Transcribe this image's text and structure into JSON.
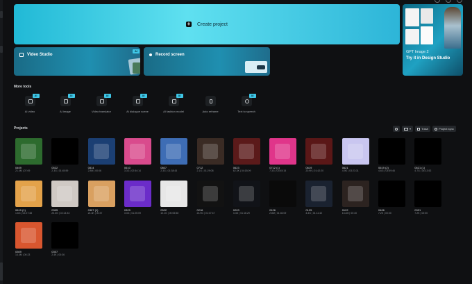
{
  "create": {
    "label": "Create project"
  },
  "tiles": {
    "video_studio": {
      "label": "Video Studio",
      "badge": "AI"
    },
    "record_screen": {
      "label": "Record screen"
    }
  },
  "promo": {
    "line1": "GPT Image 2",
    "line2": "Try it in Design Studio"
  },
  "more_tools": {
    "title": "More tools",
    "items": [
      {
        "label": "AI video",
        "icon": "ai-video-icon",
        "badge": "AI"
      },
      {
        "label": "AI image",
        "icon": "ai-image-icon",
        "badge": "AI"
      },
      {
        "label": "Video translator",
        "icon": "translate-icon",
        "badge": "AI"
      },
      {
        "label": "AI dialogue scene",
        "icon": "dialogue-icon",
        "badge": "AI"
      },
      {
        "label": "AI fashion model",
        "icon": "fashion-icon",
        "badge": "AI"
      },
      {
        "label": "Auto reframe",
        "icon": "reframe-icon"
      },
      {
        "label": "Text to speech",
        "icon": "tts-icon",
        "badge": "AI"
      }
    ]
  },
  "projects": {
    "title": "Projects",
    "actions": {
      "trash": "Trash",
      "sync": "Project sync"
    },
    "items": [
      {
        "name": "0409",
        "meta": "21.4M | 07:09",
        "color": "#2d6b2e"
      },
      {
        "name": "0522",
        "meta": "2.3G | 01:45:59",
        "color": "#000000"
      },
      {
        "name": "0814",
        "meta": "2.8M | 00:06",
        "color": "#1b3f73"
      },
      {
        "name": "0610",
        "meta": "3.3G | 02:54:14",
        "color": "#d94b8d"
      },
      {
        "name": "0807",
        "meta": "2.3G | 01:38:43",
        "color": "#3e6db5"
      },
      {
        "name": "0712",
        "meta": "2.1G | 01:29:08",
        "color": "#3a2b24"
      },
      {
        "name": "0623",
        "meta": "62.3K | 04:18:09",
        "color": "#5b1a1a"
      },
      {
        "name": "0712 (1)",
        "meta": "7.3G | 03:45:15",
        "color": "#e0358a"
      },
      {
        "name": "0619",
        "meta": "20.9K | 01:42:20",
        "color": "#5a1717"
      },
      {
        "name": "0621",
        "meta": "4.9G | 03:23:31",
        "color": "#c9c6f0"
      },
      {
        "name": "0619 (2)",
        "meta": "4.6G | 03:59:46",
        "color": "#000000"
      },
      {
        "name": "0621 (1)",
        "meta": "4.7G | 04:13:52",
        "color": "#000000"
      },
      {
        "name": "0619 (1)",
        "meta": "1.6G | 02:27:48",
        "color": "#e3a24a"
      },
      {
        "name": "0305",
        "meta": "23.3G | 02:14:33",
        "color": "#cfc9c4"
      },
      {
        "name": "0307 (1)",
        "meta": "24.3K | 00:37",
        "color": "#d9a060"
      },
      {
        "name": "0329",
        "meta": "3.3G | 01:25:09",
        "color": "#6b2cc9"
      },
      {
        "name": "0322",
        "meta": "10.1G | 00:05:58",
        "color": "#e7e7e7"
      },
      {
        "name": "0216",
        "meta": "24.9G | 01:07:47",
        "color": "#121212"
      },
      {
        "name": "0203",
        "meta": "3.4G | 01:16:29",
        "color": "#111318"
      },
      {
        "name": "0126",
        "meta": "2.8M | 01:46:09",
        "color": "#0a0a0a"
      },
      {
        "name": "0125",
        "meta": "4.3G | 01:11:42",
        "color": "#1a2230"
      },
      {
        "name": "0122",
        "meta": "13.4M | 00:40",
        "color": "#2c2320"
      },
      {
        "name": "0406",
        "meta": "7.2K | 00:00",
        "color": "#000000"
      },
      {
        "name": "0331",
        "meta": "7.2K | 00:00",
        "color": "#000000"
      },
      {
        "name": "0309",
        "meta": "14.4M | 00:23",
        "color": "#d8562f"
      },
      {
        "name": "0307",
        "meta": "2.4K | 00:36",
        "color": "#000000"
      }
    ]
  }
}
